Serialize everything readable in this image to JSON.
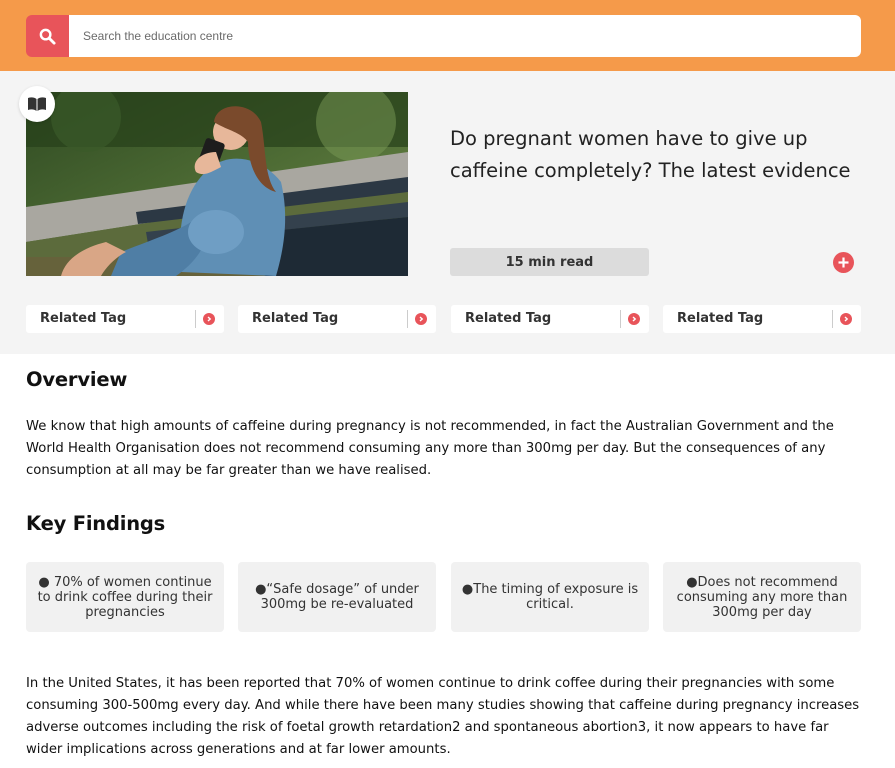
{
  "search": {
    "placeholder": "Search the education centre",
    "icon": "search-icon"
  },
  "article": {
    "badge_icon": "book-icon",
    "title": "Do pregnant women have to give up caffeine completely? The latest evidence",
    "read_time": "15 min read",
    "add_icon": "plus-icon"
  },
  "tags": [
    {
      "label": "Related Tag"
    },
    {
      "label": "Related Tag"
    },
    {
      "label": "Related Tag"
    },
    {
      "label": "Related Tag"
    }
  ],
  "overview": {
    "heading": "Overview",
    "text": "We know that high amounts of caffeine during pregnancy is not recommended, in fact the Australian Government and the World Health Organisation does not recommend consuming any more than 300mg per day. But the consequences of any consumption at all may be far greater than we have realised."
  },
  "key_findings": {
    "heading": "Key Findings",
    "items": [
      {
        "text": "● 70% of women continue to drink coffee during their pregnancies"
      },
      {
        "text": "●“Safe dosage” of under 300mg be re-evaluated"
      },
      {
        "text": "●The timing of exposure is critical."
      },
      {
        "text": "●Does not recommend consuming any more than 300mg per day"
      }
    ]
  },
  "body_text": "In the United States, it has been reported that 70% of women continue to drink coffee during their pregnancies with some consuming 300-500mg every day. And while there have been many studies showing that caffeine during pregnancy increases adverse outcomes including the risk of foetal growth retardation2 and spontaneous abortion3, it now appears to have far wider implications across generations and at far lower amounts.",
  "colors": {
    "header": "#f59a4a",
    "accent": "#e8545a",
    "panel": "#f4f4f4"
  }
}
